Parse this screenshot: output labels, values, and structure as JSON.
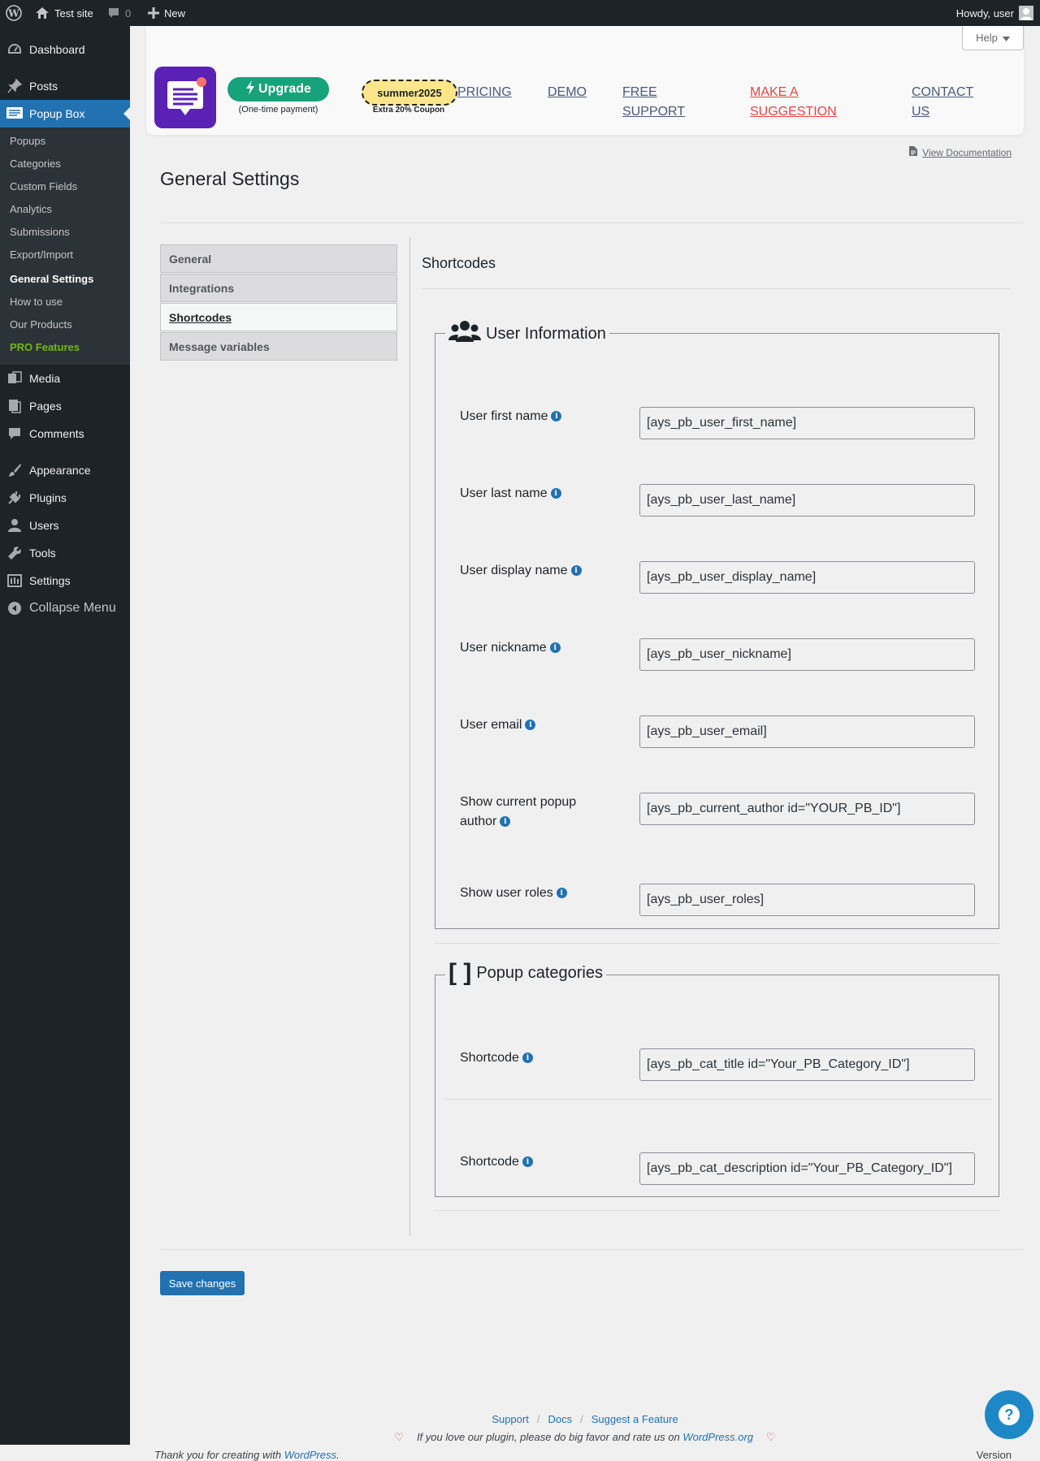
{
  "admin_bar": {
    "site_name": "Test site",
    "comments_count": "0",
    "new_label": "New",
    "greeting": "Howdy, user"
  },
  "sidebar": {
    "items": [
      {
        "label": "Dashboard",
        "icon": "dashboard-icon"
      },
      {
        "label": "Posts",
        "icon": "pin-icon"
      },
      {
        "label": "Popup Box",
        "icon": "popup-box-icon"
      },
      {
        "label": "Media",
        "icon": "media-icon"
      },
      {
        "label": "Pages",
        "icon": "pages-icon"
      },
      {
        "label": "Comments",
        "icon": "comment-icon"
      },
      {
        "label": "Appearance",
        "icon": "brush-icon"
      },
      {
        "label": "Plugins",
        "icon": "plug-icon"
      },
      {
        "label": "Users",
        "icon": "user-icon"
      },
      {
        "label": "Tools",
        "icon": "wrench-icon"
      },
      {
        "label": "Settings",
        "icon": "settings-icon"
      }
    ],
    "submenu": [
      "Popups",
      "Categories",
      "Custom Fields",
      "Analytics",
      "Submissions",
      "Export/Import",
      "General Settings",
      "How to use",
      "Our Products",
      "PRO Features"
    ],
    "collapse_label": "Collapse Menu"
  },
  "header": {
    "help_label": "Help",
    "upgrade_label": "Upgrade",
    "upgrade_note": "(One-time payment)",
    "coupon_code": "summer2025",
    "coupon_note": "Extra 20% Coupon",
    "nav": {
      "pricing": "PRICING",
      "demo": "DEMO",
      "free_support_1": "FREE",
      "free_support_2": "SUPPORT",
      "suggestion_1": "MAKE A",
      "suggestion_2": "SUGGESTION",
      "contact_1": "CONTACT",
      "contact_2": "US"
    },
    "accent_green": "#16a27a",
    "coupon_color": "#fde68a",
    "logo_color": "#5b21b6"
  },
  "view_docs_label": "View Documentation",
  "page_title": "General Settings",
  "tabs": [
    "General",
    "Integrations",
    "Shortcodes",
    "Message variables"
  ],
  "section_title": "Shortcodes",
  "user_info": {
    "title": "User Information",
    "rows": [
      {
        "label": "User first name",
        "value": "[ays_pb_user_first_name]"
      },
      {
        "label": "User last name",
        "value": "[ays_pb_user_last_name]"
      },
      {
        "label": "User display name",
        "value": "[ays_pb_user_display_name]"
      },
      {
        "label": "User nickname",
        "value": "[ays_pb_user_nickname]"
      },
      {
        "label": "User email",
        "value": "[ays_pb_user_email]"
      },
      {
        "label_line1": "Show current popup",
        "label_line2": "author",
        "value": "[ays_pb_current_author id=\"YOUR_PB_ID\"]"
      },
      {
        "label": "Show user roles",
        "value": "[ays_pb_user_roles]"
      }
    ]
  },
  "categories": {
    "title": "Popup categories",
    "rows": [
      {
        "label": "Shortcode",
        "value": "[ays_pb_cat_title id=\"Your_PB_Category_ID\"]"
      },
      {
        "label": "Shortcode",
        "value": "[ays_pb_cat_description id=\"Your_PB_Category_ID\"]"
      }
    ]
  },
  "save_label": "Save changes",
  "footer": {
    "support": "Support",
    "docs": "Docs",
    "suggest": "Suggest a Feature",
    "rate_text": "If you love our plugin, please do big favor and rate us on",
    "rate_link": "WordPress.org",
    "thanks_text": "Thank you for creating with",
    "thanks_link": "WordPress",
    "thanks_end": ".",
    "version": "Version"
  }
}
